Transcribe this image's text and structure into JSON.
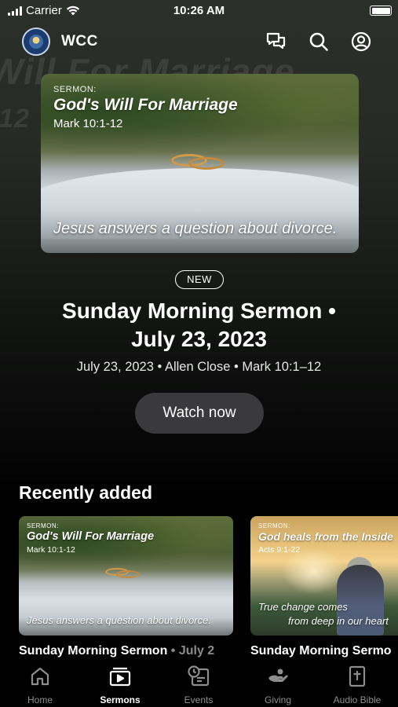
{
  "status_bar": {
    "carrier": "Carrier",
    "time": "10:26 AM"
  },
  "header": {
    "app_name": "WCC"
  },
  "background_text": {
    "line1": "Will For Marriage",
    "line2": "-12"
  },
  "hero": {
    "thumbnail": {
      "tag": "SERMON:",
      "title": "God's Will For Marriage",
      "reference": "Mark 10:1-12",
      "caption": "Jesus answers a question about divorce."
    },
    "badge": "NEW",
    "title_line1": "Sunday Morning Sermon •",
    "title_line2": "July 23, 2023",
    "meta": "July 23, 2023 • Allen Close • Mark 10:1–12",
    "watch_label": "Watch now"
  },
  "recently_added": {
    "title": "Recently added",
    "items": [
      {
        "tag": "SERMON:",
        "title": "God's Will For Marriage",
        "reference": "Mark 10:1-12",
        "caption": "Jesus answers a question about divorce.",
        "label_main": "Sunday Morning Sermon",
        "label_rest": " • July 2"
      },
      {
        "tag": "SERMON:",
        "title": "God heals from the Inside",
        "reference": "Acts 9:1-22",
        "caption_line1": "True change comes",
        "caption_line2": "from deep in our heart",
        "label_main": "Sunday Morning Sermo"
      }
    ]
  },
  "tabs": [
    {
      "label": "Home",
      "icon": "home-icon",
      "active": false
    },
    {
      "label": "Sermons",
      "icon": "sermons-icon",
      "active": true
    },
    {
      "label": "Events",
      "icon": "events-icon",
      "active": false
    },
    {
      "label": "Giving",
      "icon": "giving-icon",
      "active": false
    },
    {
      "label": "Audio Bible",
      "icon": "audio-bible-icon",
      "active": false
    }
  ],
  "colors": {
    "background": "#000000",
    "button_bg": "#3a3a3c",
    "inactive_tab": "#8d8d8d"
  }
}
